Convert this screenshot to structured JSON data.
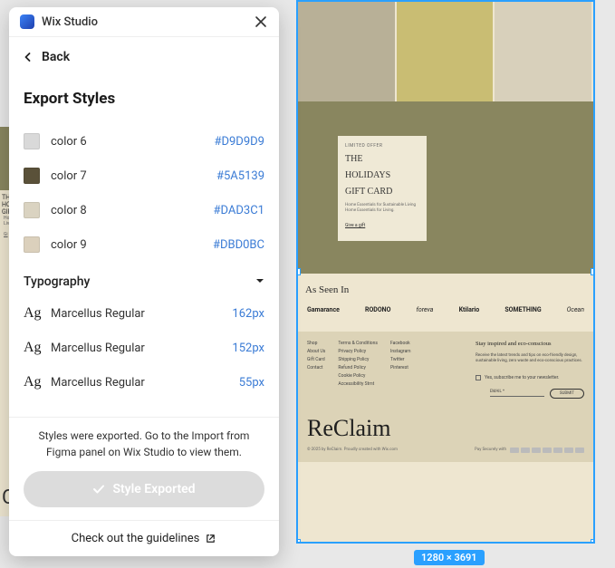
{
  "panel": {
    "app_name": "Wix Studio",
    "back_label": "Back",
    "title": "Export Styles",
    "colors": [
      {
        "name": "color 6",
        "hex": "#D9D9D9",
        "swatch": "#D9D9D9"
      },
      {
        "name": "color 7",
        "hex": "#5A5139",
        "swatch": "#5A5139"
      },
      {
        "name": "color 8",
        "hex": "#DAD3C1",
        "swatch": "#DAD3C1"
      },
      {
        "name": "color 9",
        "hex": "#DBD0BC",
        "swatch": "#DBD0BC"
      }
    ],
    "typography_label": "Typography",
    "typography": [
      {
        "sample": "Ag",
        "name": "Marcellus Regular",
        "size": "162px"
      },
      {
        "sample": "Ag",
        "name": "Marcellus Regular",
        "size": "152px"
      },
      {
        "sample": "Ag",
        "name": "Marcellus Regular",
        "size": "55px"
      }
    ],
    "export_message": "Styles were exported. Go to the Import from Figma panel on Wix Studio to view them.",
    "exported_button": "Style Exported",
    "guidelines_label": "Check out the guidelines"
  },
  "canvas": {
    "dimensions_badge": "1280 × 3691",
    "card": {
      "limited": "LIMITED OFFER",
      "title1": "THE",
      "title2": "HOLIDAYS",
      "title3": "GIFT CARD",
      "sub": "Home Essentials for Sustainable Living Home Essentials for Living.",
      "link": "Give a gift"
    },
    "brands_title": "As Seen In",
    "brands": [
      "Gamarance",
      "RODONO",
      "foreva",
      "Ktilario",
      "SOMETHING",
      "Ocean"
    ],
    "footer": {
      "col1": [
        "Shop",
        "About Us",
        "Gift Card",
        "Contact"
      ],
      "col2": [
        "Terms & Conditions",
        "Privacy Policy",
        "Shipping Policy",
        "Refund Policy",
        "Cookie Policy",
        "Accessibility Stmt"
      ],
      "col3": [
        "Facebook",
        "Instagram",
        "Twitter",
        "Pinterest"
      ],
      "heading": "Stay inspired and eco-conscious",
      "para": "Receive the latest trends and tips on eco-friendly design, sustainable living, zero waste and eco-conscious practices.",
      "checkbox": "Yes, subscribe me to your newsletter.",
      "email": "EMAIL *",
      "submit": "SUBMIT",
      "logo": "ReClaim",
      "copyright": "© 2025 by ReClaim. Proudly created with Wix.com",
      "pay": "Pay Securely with"
    },
    "left_sliver": {
      "t1": "THE",
      "t2": "HO",
      "t3": "GIF",
      "s1": "Home",
      "s2": "Living",
      "link": "Gi",
      "logo": "C"
    }
  }
}
